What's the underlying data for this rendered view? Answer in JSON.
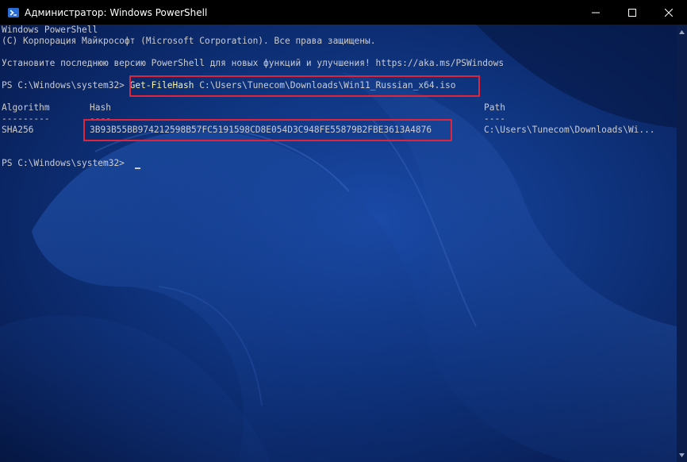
{
  "window": {
    "title": "Администратор: Windows PowerShell",
    "caption": {
      "minimize_icon": "minimize-icon",
      "maximize_icon": "maximize-icon",
      "close_icon": "close-icon"
    }
  },
  "console": {
    "banner_line1": "Windows PowerShell",
    "banner_line2": "(C) Корпорация Майкрософт (Microsoft Corporation). Все права защищены.",
    "update_line": "Установите последнюю версию PowerShell для новых функций и улучшения! https://aka.ms/PSWindows",
    "prompt1": "PS C:\\Windows\\system32> ",
    "command_name": "Get-FileHash",
    "command_arg": " C:\\Users\\Tunecom\\Downloads\\Win11_Russian_x64.iso",
    "table": {
      "header_algorithm": "Algorithm",
      "header_hash": "Hash",
      "header_path": "Path",
      "sep_algorithm": "---------",
      "sep_hash": "----",
      "sep_path": "----",
      "row_algorithm": "SHA256",
      "row_hash": "3B93B55BB974212598B57FC5191598CD8E054D3C948FE55879B2FBE3613A4876",
      "row_path": "C:\\Users\\Tunecom\\Downloads\\Wi..."
    },
    "prompt2": "PS C:\\Windows\\system32> "
  },
  "colors": {
    "highlight_border": "#e0243a",
    "command_color": "#f9f1a5",
    "text_color": "#cccccc",
    "background": "#0a2a6e"
  }
}
